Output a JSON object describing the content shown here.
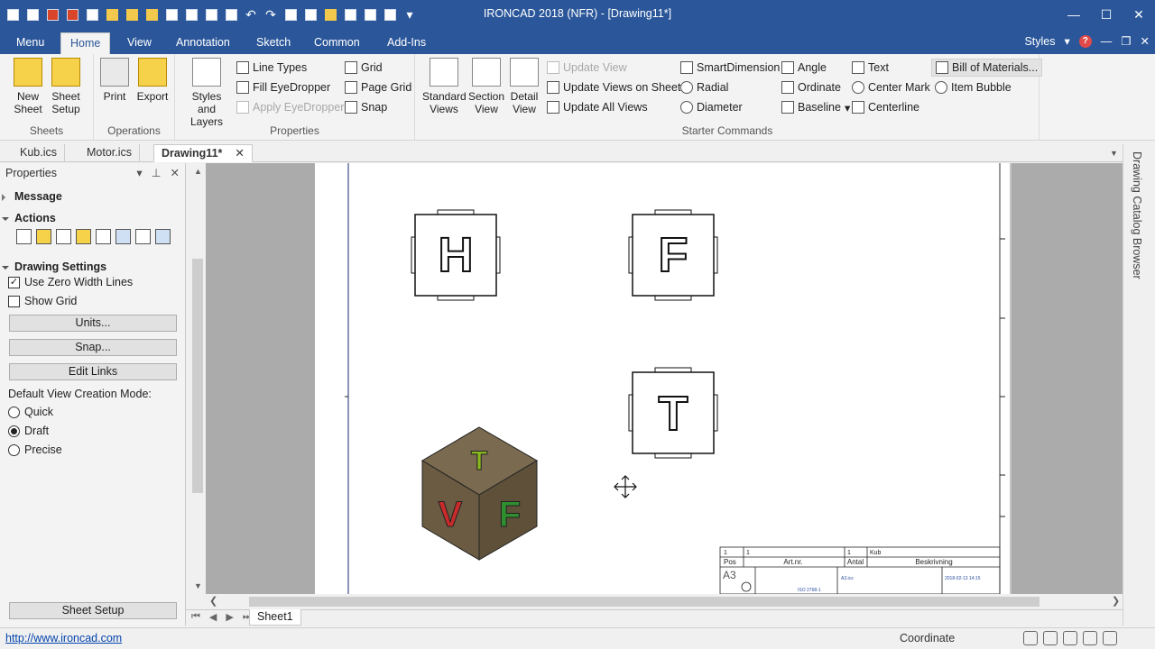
{
  "window": {
    "title": "IRONCAD 2018 (NFR) - [Drawing11*]"
  },
  "ribbon_tabs": [
    "Menu",
    "Home",
    "View",
    "Annotation",
    "Sketch",
    "Common",
    "Add-Ins"
  ],
  "styles_label": "Styles",
  "groups": {
    "sheets": {
      "label": "Sheets",
      "new_sheet": "New Sheet",
      "sheet_setup": "Sheet Setup"
    },
    "operations": {
      "label": "Operations",
      "print": "Print",
      "export": "Export"
    },
    "properties": {
      "label": "Properties",
      "styles_layers": "Styles and Layers",
      "line_types": "Line Types",
      "fill_eyedropper": "Fill EyeDropper",
      "apply_eyedropper": "Apply EyeDropper",
      "grid": "Grid",
      "page_grid": "Page Grid",
      "snap": "Snap"
    },
    "views": {
      "standard_views": "Standard Views",
      "section_view": "Section View",
      "detail_view": "Detail View",
      "update_view": "Update View",
      "update_views_on_sheet": "Update Views on Sheet",
      "update_all_views": "Update All Views"
    },
    "starter": {
      "label": "Starter Commands",
      "smart_dimension": "SmartDimension",
      "radial": "Radial",
      "diameter": "Diameter",
      "angle": "Angle",
      "ordinate": "Ordinate",
      "baseline": "Baseline",
      "text": "Text",
      "center_mark": "Center Mark",
      "centerline": "Centerline",
      "bom": "Bill of Materials...",
      "item_bubble": "Item Bubble"
    }
  },
  "doc_tabs": [
    "Kub.ics",
    "Motor.ics",
    "Drawing11*"
  ],
  "properties": {
    "title": "Properties",
    "message": "Message",
    "actions": "Actions",
    "drawing_settings": "Drawing Settings",
    "use_zero_width": "Use Zero Width Lines",
    "show_grid": "Show Grid",
    "units": "Units...",
    "snap": "Snap...",
    "edit_links": "Edit Links",
    "mode_label": "Default View Creation Mode:",
    "modes": [
      "Quick",
      "Draft",
      "Precise"
    ],
    "selected_mode": "Draft",
    "sheet_setup": "Sheet Setup"
  },
  "views": {
    "top_left": "H",
    "top_right": "F",
    "middle_right": "T",
    "iso_top": "T",
    "iso_left": "V",
    "iso_right": "F"
  },
  "title_block": {
    "pos_h": "Pos",
    "artnr_h": "Art.nr.",
    "antal_h": "Antal",
    "beskr_h": "Beskrivning",
    "row_pos": "1",
    "row_art": "1",
    "row_antal": "1",
    "row_beskr": "Kub",
    "size": "A3",
    "standard": "ISO 2768-1",
    "date": "2018-02-13 14:15",
    "file": "A3.ics"
  },
  "sheet_tab": "Sheet1",
  "right_panel": "Drawing Catalog Browser",
  "status": {
    "url": "http://www.ironcad.com",
    "coord": "Coordinate"
  }
}
